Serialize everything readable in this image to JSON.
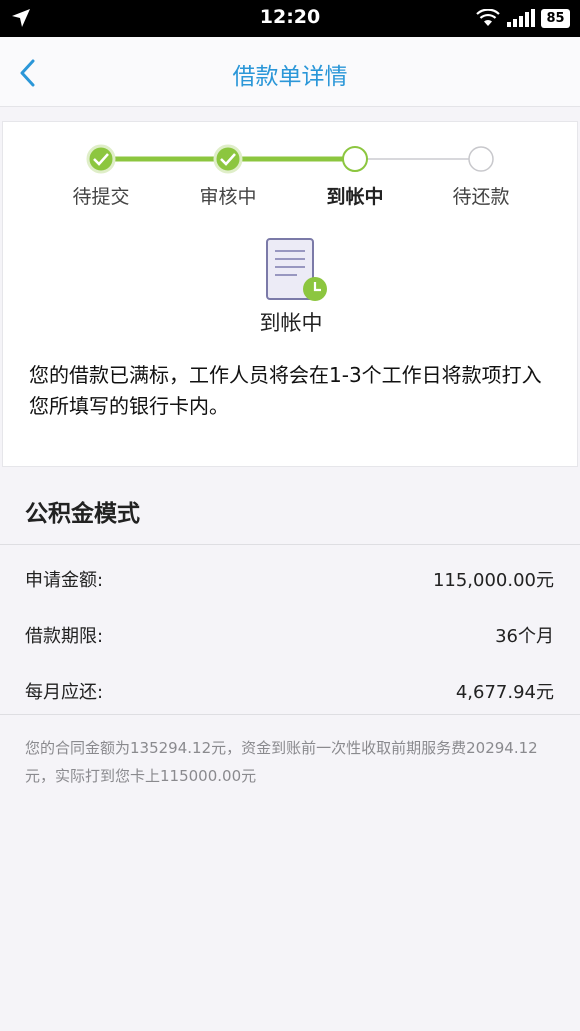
{
  "status_bar": {
    "time": "12:20",
    "battery": "85"
  },
  "nav": {
    "title": "借款单详情"
  },
  "steps": [
    {
      "label": "待提交",
      "state": "done"
    },
    {
      "label": "审核中",
      "state": "done"
    },
    {
      "label": "到帐中",
      "state": "current"
    },
    {
      "label": "待还款",
      "state": "pending"
    }
  ],
  "status": {
    "title": "到帐中",
    "description": "您的借款已满标，工作人员将会在1-3个工作日将款项打入您所填写的银行卡内。"
  },
  "mode": {
    "title": "公积金模式"
  },
  "details": [
    {
      "label": "申请金额:",
      "value": "115,000.00元"
    },
    {
      "label": "借款期限:",
      "value": "36个月"
    },
    {
      "label": "每月应还:",
      "value": "4,677.94元"
    }
  ],
  "note": "您的合同金额为135294.12元，资金到账前一次性收取前期服务费20294.12元，实际打到您卡上115000.00元",
  "colors": {
    "accent": "#2b97d8",
    "progress": "#8cc63f"
  }
}
